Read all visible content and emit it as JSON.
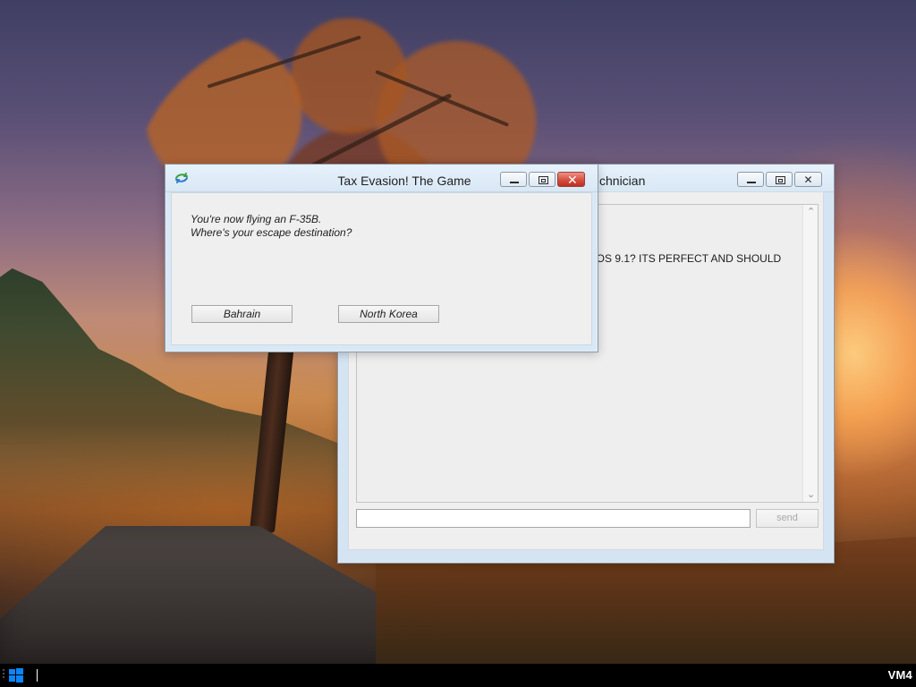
{
  "desktop": {
    "background_scene": "autumn road with trees at sunset"
  },
  "dialog": {
    "title": "Tax Evasion! The Game",
    "message_line_1": "You're now flying an F-35B.",
    "message_line_2": "Where's your escape destination?",
    "buttons": [
      {
        "label": "Bahrain"
      },
      {
        "label": "North Korea"
      }
    ],
    "icon": "app-icon"
  },
  "background_window": {
    "title_visible": "chnician",
    "chat_text": "DOS 9.1? ITS PERFECT AND SHOULD",
    "input_value": "",
    "send_label": "send"
  },
  "taskbar": {
    "vm_label": "VM4",
    "start_icon": "windows-logo-icon",
    "grid_icon": "grid-icon"
  },
  "colors": {
    "window_titlebar": "#d9e8f6",
    "dialog_close_red": "#d44c3d",
    "taskbar": "#000000"
  }
}
